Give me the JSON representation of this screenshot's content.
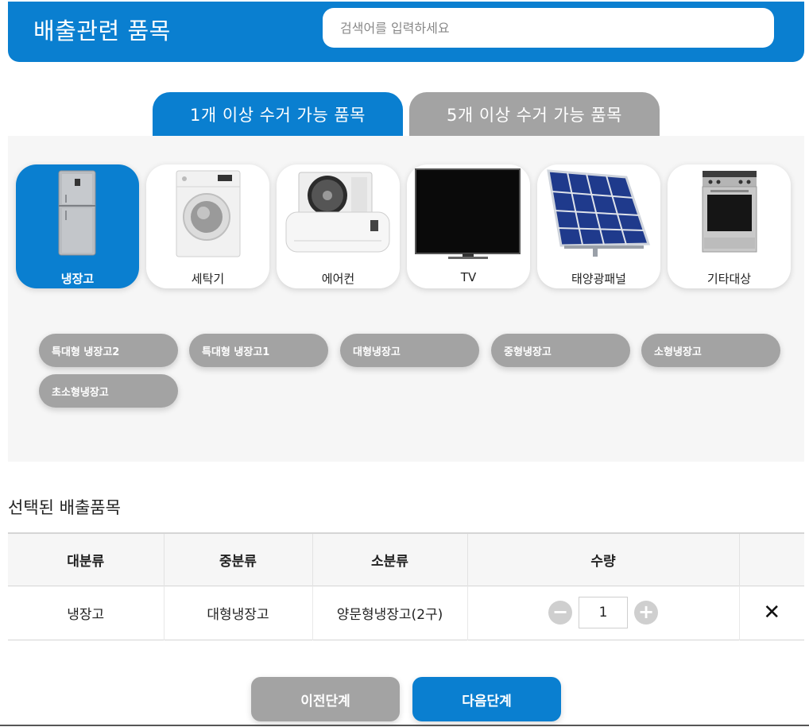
{
  "header": {
    "title": "배출관련 품목",
    "search_placeholder": "검색어를 입력하세요"
  },
  "tabs": [
    {
      "label": "1개 이상 수거 가능 품목",
      "active": true
    },
    {
      "label": "5개 이상 수거 가능 품목",
      "active": false
    }
  ],
  "categories": [
    {
      "label": "냉장고",
      "icon": "refrigerator-icon",
      "active": true
    },
    {
      "label": "세탁기",
      "icon": "washing-machine-icon",
      "active": false
    },
    {
      "label": "에어컨",
      "icon": "air-conditioner-icon",
      "active": false
    },
    {
      "label": "TV",
      "icon": "tv-icon",
      "active": false
    },
    {
      "label": "태양광패널",
      "icon": "solar-panel-icon",
      "active": false
    },
    {
      "label": "기타대상",
      "icon": "stove-icon",
      "active": false
    }
  ],
  "subcategories": [
    "특대형 냉장고2",
    "특대형 냉장고1",
    "대형냉장고",
    "중형냉장고",
    "소형냉장고",
    "초소형냉장고"
  ],
  "selected": {
    "title": "선택된 배출품목",
    "columns": [
      "대분류",
      "중분류",
      "소분류",
      "수량",
      ""
    ],
    "rows": [
      {
        "major": "냉장고",
        "middle": "대형냉장고",
        "minor": "양문형냉장고(2구)",
        "quantity": "1"
      }
    ]
  },
  "buttons": {
    "prev": "이전단계",
    "next": "다음단계"
  },
  "colors": {
    "primary": "#0a7fd0",
    "inactive": "#a3a3a3",
    "panel_bg": "#f6f6f6"
  }
}
